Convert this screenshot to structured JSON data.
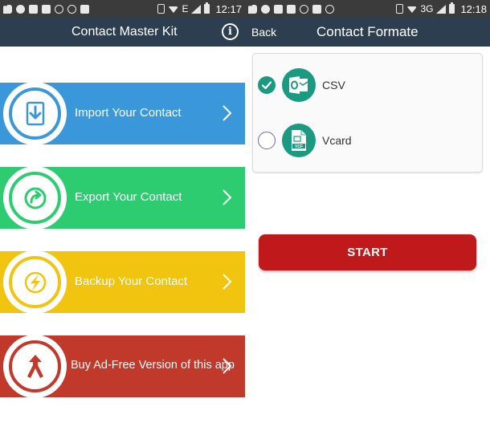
{
  "left_screen": {
    "status": {
      "network": "E",
      "time": "12:17"
    },
    "appbar": {
      "title": "Contact Master Kit",
      "info_icon": "info-icon"
    },
    "menu": [
      {
        "label": "Import Your Contact",
        "color": "#3a97da",
        "icon": "import-icon"
      },
      {
        "label": "Export Your Contact",
        "color": "#2ecc71",
        "icon": "export-icon"
      },
      {
        "label": "Backup Your Contact",
        "color": "#f1c40f",
        "icon": "backup-icon"
      },
      {
        "label": "Buy Ad-Free Version of this app",
        "color": "#c0392b",
        "icon": "merge-arrow-icon"
      }
    ]
  },
  "right_screen": {
    "status": {
      "network": "3G",
      "time": "12:18"
    },
    "appbar": {
      "back_label": "Back",
      "title": "Contact Formate"
    },
    "formats": [
      {
        "label": "CSV",
        "selected": true,
        "icon": "outlook-icon"
      },
      {
        "label": "Vcard",
        "selected": false,
        "icon": "vcf-file-icon"
      }
    ],
    "start_label": "START"
  },
  "colors": {
    "appbar": "#2c3e50",
    "statusbar": "#3b3b3b",
    "accent": "#1a9a80",
    "start": "#c0191b"
  }
}
